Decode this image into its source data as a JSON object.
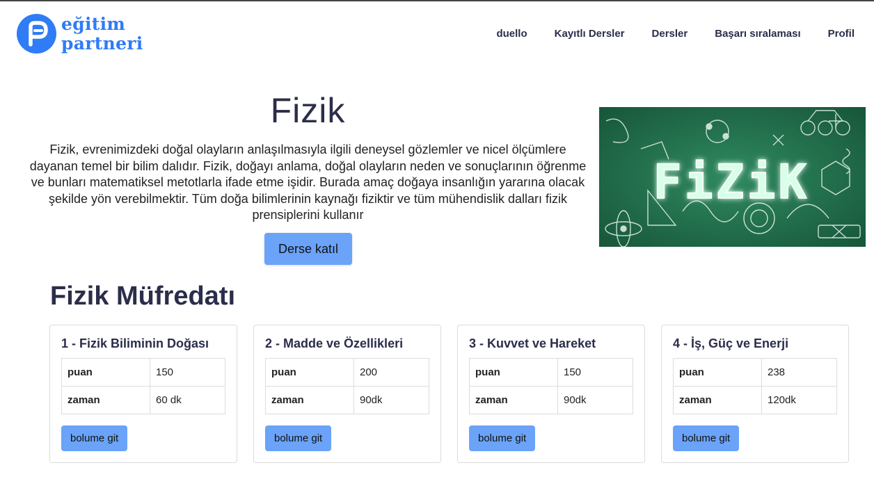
{
  "brand": {
    "line1": "eğitim",
    "line2": "partneri",
    "color": "#2f7cf6"
  },
  "nav": [
    {
      "label": "duello"
    },
    {
      "label": "Kayıtlı Dersler"
    },
    {
      "label": "Dersler"
    },
    {
      "label": "Başarı sıralaması"
    },
    {
      "label": "Profil"
    }
  ],
  "hero": {
    "title": "Fizik",
    "description": "Fizik, evrenimizdeki doğal olayların anlaşılmasıyla ilgili deneysel gözlemler ve nicel ölçümlere dayanan temel bir bilim dalıdır. Fizik, doğayı anlama, doğal olayların neden ve sonuçlarının öğrenme ve bunları matematiksel metotlarla ifade etme işidir. Burada amaç doğaya insanlığın yararına olacak şekilde yön verebilmektir. Tüm doğa bilimlerinin kaynağı fiziktir ve tüm mühendislik dalları fizik prensiplerini kullanır",
    "join_label": "Derse katıl",
    "image_text": "FiZiK"
  },
  "curriculum": {
    "title": "Fizik Müfredatı",
    "units": [
      {
        "title": "1 - Fizik Biliminin Doğası",
        "score_label": "puan",
        "score": "150",
        "time_label": "zaman",
        "time": "60 dk",
        "button": "bolume git"
      },
      {
        "title": "2 - Madde ve Özellikleri",
        "score_label": "puan",
        "score": "200",
        "time_label": "zaman",
        "time": "90dk",
        "button": "bolume git"
      },
      {
        "title": "3 - Kuvvet ve Hareket",
        "score_label": "puan",
        "score": "150",
        "time_label": "zaman",
        "time": "90dk",
        "button": "bolume git"
      },
      {
        "title": "4 - İş, Güç ve Enerji",
        "score_label": "puan",
        "score": "238",
        "time_label": "zaman",
        "time": "120dk",
        "button": "bolume git"
      }
    ]
  },
  "colors": {
    "accent_button": "#6aa3f8",
    "text_dark": "#2b2d4a",
    "chalkboard": "#1f6b4a"
  }
}
